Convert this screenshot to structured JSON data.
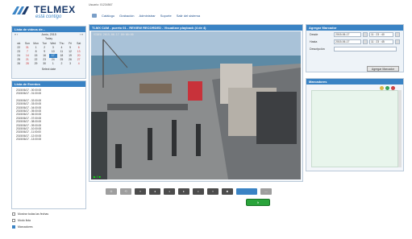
{
  "brand": {
    "name": "TELMEX",
    "tagline": "está contigo",
    "color": "#1a3a6b"
  },
  "header": {
    "user_line": "Usuario: 01234567",
    "nav": [
      "Catálogo",
      "Grabación",
      "Administrar",
      "Soporte",
      "Salir del sistema"
    ]
  },
  "calendar": {
    "title": "Lista de videos de...",
    "month_label": "Junio, 2015",
    "prev_label": "« ‹",
    "next_label": "› »",
    "today_label": "Today",
    "weekdays": [
      "wk",
      "Sun",
      "Mon",
      "Tue",
      "Wed",
      "Thu",
      "Fri",
      "Sat"
    ],
    "weeks": [
      [
        "22",
        "31",
        "1",
        "2",
        "3",
        "4",
        "5",
        "6"
      ],
      [
        "23",
        "7",
        "8",
        "9",
        "10",
        "11",
        "12",
        "13"
      ],
      [
        "24",
        "14",
        "15",
        "16",
        "17",
        "18",
        "19",
        "20"
      ],
      [
        "25",
        "21",
        "22",
        "23",
        "24",
        "25",
        "26",
        "27"
      ],
      [
        "26",
        "28",
        "29",
        "30",
        "1",
        "2",
        "3",
        "4"
      ]
    ],
    "selected_day": "17",
    "select_button": "Select date"
  },
  "event_list": {
    "title": "Lista de Eventos",
    "group1": [
      "2015/06/17 - 00:00:00",
      "2015/06/17 - 01:00:00"
    ],
    "group2": [
      "2015/06/17 - 02:00:00",
      "2015/06/17 - 03:00:00",
      "2015/06/17 - 04:00:00",
      "2015/06/17 - 05:00:00",
      "2015/06/17 - 06:00:00",
      "2015/06/17 - 07:00:00",
      "2015/06/17 - 08:00:00",
      "2015/06/17 - 09:00:00",
      "2015/06/17 - 10:00:00",
      "2015/06/17 - 11:00:00",
      "2015/06/17 - 12:00:00",
      "2015/06/17 - 13:00:00"
    ]
  },
  "options": [
    {
      "label": "Mostrar todas las fechas",
      "checked": false
    },
    {
      "label": "Modo lista",
      "checked": false
    },
    {
      "label": "Marcadores",
      "checked": true
    }
  ],
  "camera": {
    "title": "TLMX CAM - puerto 01 - REVIEW RECORDED - Visualizar playback (4 de 4)",
    "osd": "VIDEO 2015-06-17  00:00:00",
    "status": "▶ II ■"
  },
  "playback_controls": [
    "◘",
    "⟲",
    "«",
    "◂",
    "◃",
    "▸",
    "▹",
    "»",
    "■",
    "",
    "—"
  ],
  "go_button": "Ir",
  "add_marker": {
    "title": "Agregar Marcador",
    "from_label": "Desde",
    "to_label": "Hasta",
    "desc_label": "Descripción",
    "from_date": "2015-06-17",
    "from_time": "11 : 23 : 40",
    "to_date": "2015-06-17",
    "to_time": "11 : 23 : 45",
    "button": "Agregar Marcador"
  },
  "markers": {
    "title": "Marcadores"
  },
  "colors": {
    "accent": "#3a83c4",
    "go": "#29a33a"
  }
}
